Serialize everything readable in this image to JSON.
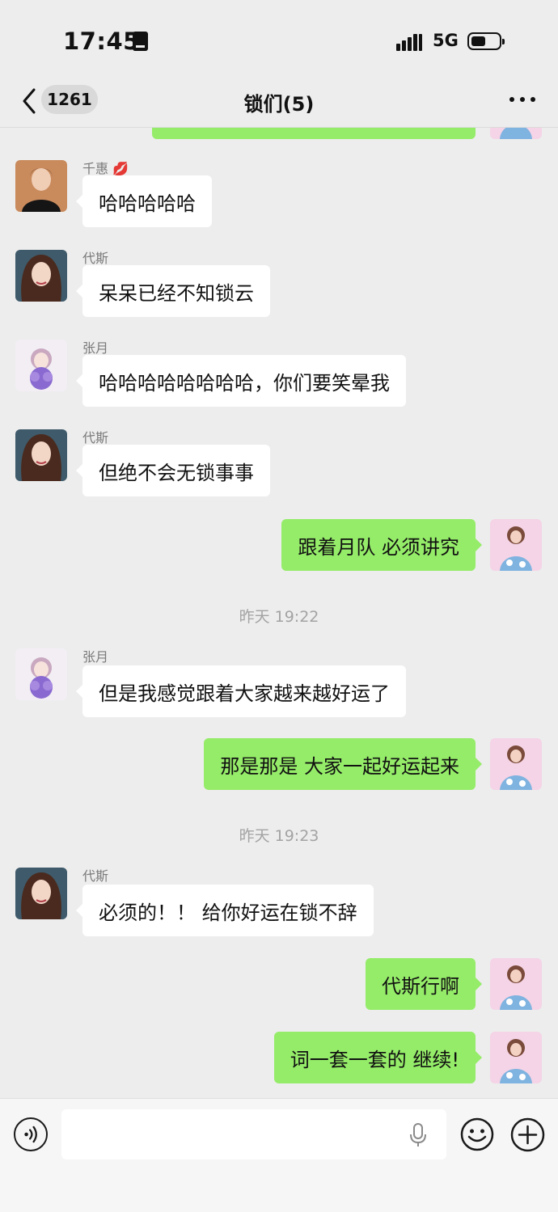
{
  "status_bar": {
    "time": "17:45",
    "network": "5G"
  },
  "nav": {
    "unread_count": "1261",
    "title": "锁们(5)"
  },
  "messages": [
    {
      "type": "in",
      "sender": "千惠 💋",
      "text": "哈哈哈哈哈",
      "avatar": "avatar-qianhui"
    },
    {
      "type": "in",
      "sender": "代斯",
      "text": "呆呆已经不知锁云",
      "avatar": "avatar-daisi"
    },
    {
      "type": "in",
      "sender": "张月",
      "text": "哈哈哈哈哈哈哈哈，你们要笑晕我",
      "avatar": "avatar-zhangyue"
    },
    {
      "type": "in",
      "sender": "代斯",
      "text": "但绝不会无锁事事",
      "avatar": "avatar-daisi"
    },
    {
      "type": "out",
      "text": "跟着月队 必须讲究",
      "avatar": "avatar-me"
    },
    {
      "type": "time",
      "text": "昨天 19:22"
    },
    {
      "type": "in",
      "sender": "张月",
      "text": "但是我感觉跟着大家越来越好运了",
      "avatar": "avatar-zhangyue"
    },
    {
      "type": "out",
      "text": "那是那是 大家一起好运起来",
      "avatar": "avatar-me"
    },
    {
      "type": "time",
      "text": "昨天 19:23"
    },
    {
      "type": "in",
      "sender": "代斯",
      "text": "必须的！！ 给你好运在锁不辞",
      "avatar": "avatar-daisi"
    },
    {
      "type": "out",
      "text": "代斯行啊",
      "avatar": "avatar-me"
    },
    {
      "type": "out",
      "text": "词一套一套的 继续!",
      "avatar": "avatar-me"
    }
  ],
  "input": {
    "placeholder": ""
  },
  "colors": {
    "background": "#ededed",
    "outgoing_bubble": "#95ec69",
    "incoming_bubble": "#ffffff"
  }
}
